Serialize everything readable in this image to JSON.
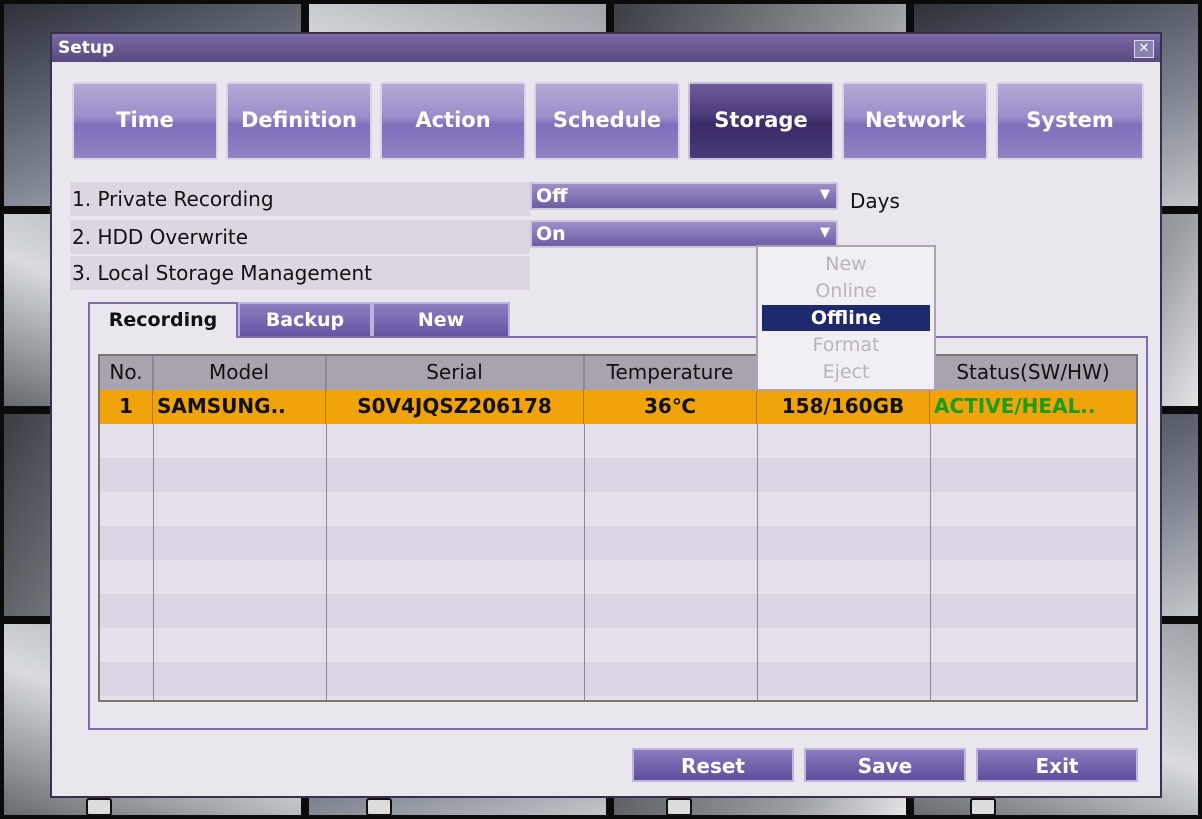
{
  "window": {
    "title": "Setup",
    "close_glyph": "✕"
  },
  "tabs": [
    {
      "label": "Time"
    },
    {
      "label": "Definition"
    },
    {
      "label": "Action"
    },
    {
      "label": "Schedule"
    },
    {
      "label": "Storage",
      "active": true
    },
    {
      "label": "Network"
    },
    {
      "label": "System"
    }
  ],
  "settings": {
    "private_recording": {
      "label": "1. Private Recording",
      "value": "Off",
      "suffix": "Days"
    },
    "hdd_overwrite": {
      "label": "2. HDD Overwrite",
      "value": "On"
    },
    "local_storage": {
      "label": "3. Local Storage Management"
    }
  },
  "subtabs": [
    {
      "label": "Recording",
      "active": true
    },
    {
      "label": "Backup"
    },
    {
      "label": "New"
    }
  ],
  "table": {
    "headers": [
      "No.",
      "Model",
      "Serial",
      "Temperature",
      "",
      "Status(SW/HW)"
    ],
    "rows": [
      {
        "no": "1",
        "model": "SAMSUNG..",
        "serial": "S0V4JQSZ206178",
        "temperature": "36℃",
        "capacity": "158/160GB",
        "status": "ACTIVE/HEAL.."
      }
    ]
  },
  "dropdown": {
    "items": [
      "New",
      "Online",
      "Offline",
      "Format",
      "Eject"
    ],
    "selected": "Offline"
  },
  "buttons": {
    "reset": "Reset",
    "save": "Save",
    "exit": "Exit"
  },
  "colors": {
    "accent": "#5a4880",
    "highlight_row": "#f0a30a",
    "status_ok": "#1a9e1a",
    "dropdown_selected": "#1f2a6e"
  }
}
